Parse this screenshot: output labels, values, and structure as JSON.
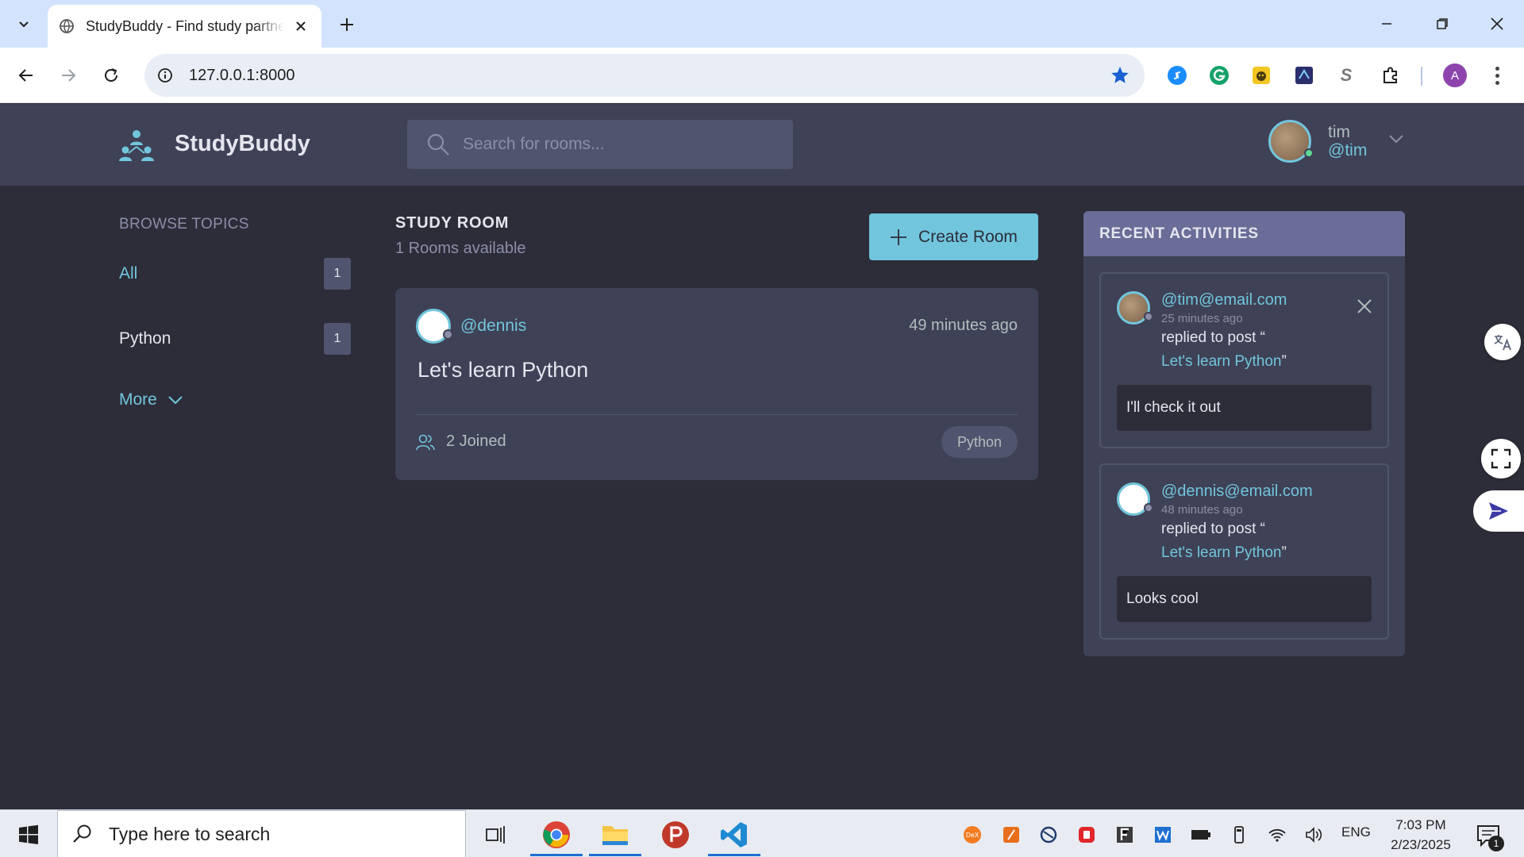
{
  "browser": {
    "tab_title": "StudyBuddy - Find study partners",
    "url": "127.0.0.1:8000",
    "profile_initial": "A"
  },
  "app": {
    "brand": "StudyBuddy",
    "search_placeholder": "Search for rooms...",
    "user": {
      "name": "tim",
      "handle": "@tim"
    }
  },
  "topics": {
    "title": "BROWSE TOPICS",
    "items": [
      {
        "label": "All",
        "count": "1"
      },
      {
        "label": "Python",
        "count": "1"
      }
    ],
    "more_label": "More"
  },
  "rooms": {
    "title": "STUDY ROOM",
    "subtitle": "1 Rooms available",
    "create_label": "Create Room",
    "list": [
      {
        "host": "@dennis",
        "time": "49 minutes ago",
        "name": "Let's learn Python",
        "joined": "2 Joined",
        "topic": "Python"
      }
    ]
  },
  "activities": {
    "title": "RECENT ACTIVITIES",
    "items": [
      {
        "user": "@tim@email.com",
        "time": "25 minutes ago",
        "action": "replied to post “",
        "post": "Let's learn Python",
        "post_end": "”",
        "message": "I'll check it out"
      },
      {
        "user": "@dennis@email.com",
        "time": "48 minutes ago",
        "action": "replied to post “",
        "post": "Let's learn Python",
        "post_end": "”",
        "message": "Looks cool"
      }
    ]
  },
  "taskbar": {
    "search_text": "Type here to search",
    "lang": "ENG",
    "time": "7:03 PM",
    "date": "2/23/2025",
    "notif_count": "1"
  },
  "colors": {
    "bg": "#2d2d39",
    "panel": "#3f4156",
    "accent": "#71c6dd",
    "activities_header": "#696d97"
  }
}
